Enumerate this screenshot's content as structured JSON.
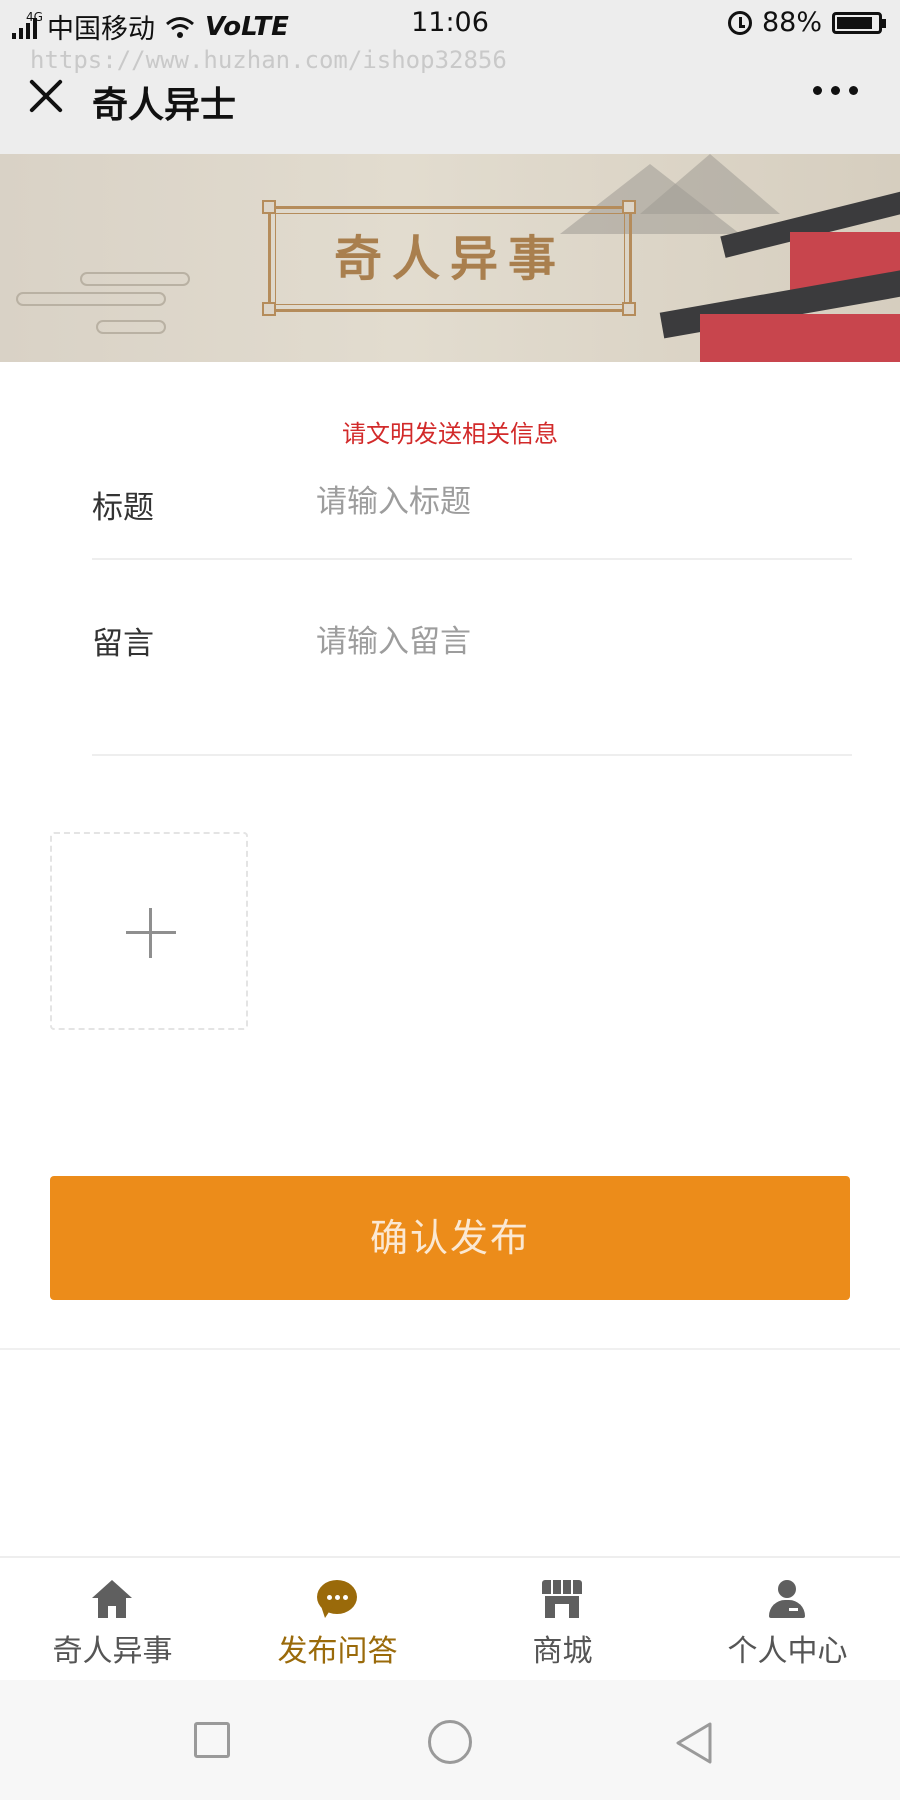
{
  "status_bar": {
    "network_type": "4G",
    "carrier": "中国移动",
    "volte": "VoLTE",
    "time": "11:06",
    "battery": "88%",
    "battery_level": 0.88
  },
  "navbar": {
    "watermark": "https://www.huzhan.com/ishop32856",
    "title": "奇人异士"
  },
  "banner": {
    "title": "奇人异事"
  },
  "form": {
    "notice": "请文明发送相关信息",
    "title_label": "标题",
    "title_placeholder": "请输入标题",
    "message_label": "留言",
    "message_placeholder": "请输入留言",
    "submit_label": "确认发布"
  },
  "tabbar": {
    "items": [
      {
        "label": "奇人异事",
        "icon": "home-icon"
      },
      {
        "label": "发布问答",
        "icon": "chat-icon"
      },
      {
        "label": "商城",
        "icon": "store-icon"
      },
      {
        "label": "个人中心",
        "icon": "user-icon"
      }
    ],
    "active_index": 1
  },
  "colors": {
    "accent": "#ec8c1a",
    "active_tab": "#9a6a0a",
    "notice": "#d22a2a"
  }
}
